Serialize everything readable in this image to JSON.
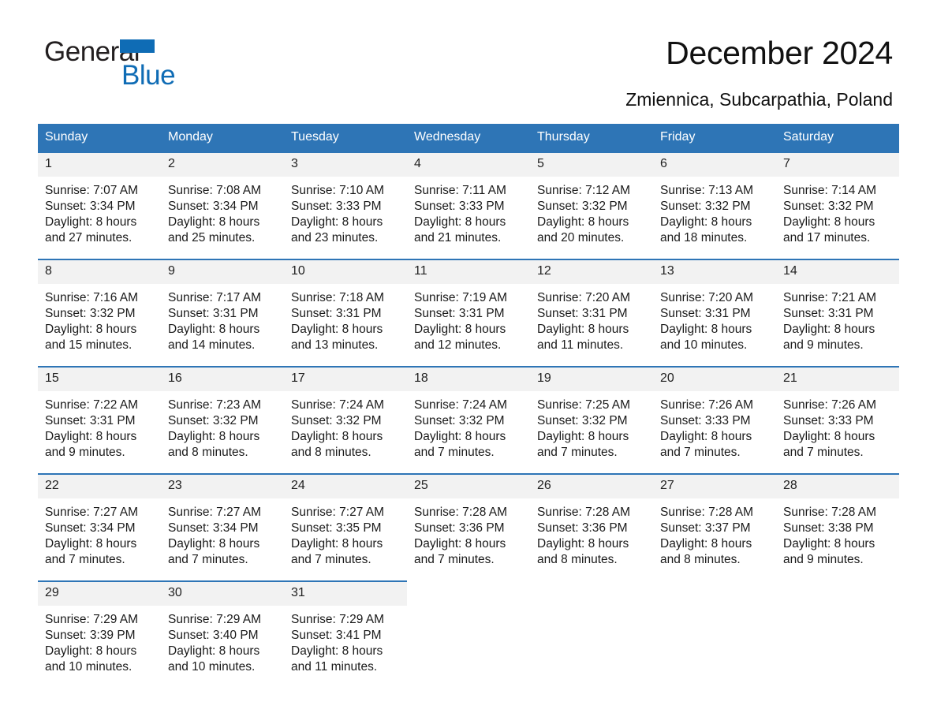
{
  "brand": {
    "logo_word_one": "General",
    "logo_word_two": "Blue",
    "logo_triangle_icon": "triangle-icon",
    "accent_color": "#0f6cb5"
  },
  "header": {
    "title": "December 2024",
    "subtitle": "Zmiennica, Subcarpathia, Poland"
  },
  "calendar": {
    "header_bg_color": "#2e75b6",
    "daynum_bg_color": "#f2f2f2",
    "weekday_headers": [
      "Sunday",
      "Monday",
      "Tuesday",
      "Wednesday",
      "Thursday",
      "Friday",
      "Saturday"
    ],
    "weeks": [
      [
        {
          "day": "1",
          "sunrise": "Sunrise: 7:07 AM",
          "sunset": "Sunset: 3:34 PM",
          "daylight_1": "Daylight: 8 hours",
          "daylight_2": "and 27 minutes."
        },
        {
          "day": "2",
          "sunrise": "Sunrise: 7:08 AM",
          "sunset": "Sunset: 3:34 PM",
          "daylight_1": "Daylight: 8 hours",
          "daylight_2": "and 25 minutes."
        },
        {
          "day": "3",
          "sunrise": "Sunrise: 7:10 AM",
          "sunset": "Sunset: 3:33 PM",
          "daylight_1": "Daylight: 8 hours",
          "daylight_2": "and 23 minutes."
        },
        {
          "day": "4",
          "sunrise": "Sunrise: 7:11 AM",
          "sunset": "Sunset: 3:33 PM",
          "daylight_1": "Daylight: 8 hours",
          "daylight_2": "and 21 minutes."
        },
        {
          "day": "5",
          "sunrise": "Sunrise: 7:12 AM",
          "sunset": "Sunset: 3:32 PM",
          "daylight_1": "Daylight: 8 hours",
          "daylight_2": "and 20 minutes."
        },
        {
          "day": "6",
          "sunrise": "Sunrise: 7:13 AM",
          "sunset": "Sunset: 3:32 PM",
          "daylight_1": "Daylight: 8 hours",
          "daylight_2": "and 18 minutes."
        },
        {
          "day": "7",
          "sunrise": "Sunrise: 7:14 AM",
          "sunset": "Sunset: 3:32 PM",
          "daylight_1": "Daylight: 8 hours",
          "daylight_2": "and 17 minutes."
        }
      ],
      [
        {
          "day": "8",
          "sunrise": "Sunrise: 7:16 AM",
          "sunset": "Sunset: 3:32 PM",
          "daylight_1": "Daylight: 8 hours",
          "daylight_2": "and 15 minutes."
        },
        {
          "day": "9",
          "sunrise": "Sunrise: 7:17 AM",
          "sunset": "Sunset: 3:31 PM",
          "daylight_1": "Daylight: 8 hours",
          "daylight_2": "and 14 minutes."
        },
        {
          "day": "10",
          "sunrise": "Sunrise: 7:18 AM",
          "sunset": "Sunset: 3:31 PM",
          "daylight_1": "Daylight: 8 hours",
          "daylight_2": "and 13 minutes."
        },
        {
          "day": "11",
          "sunrise": "Sunrise: 7:19 AM",
          "sunset": "Sunset: 3:31 PM",
          "daylight_1": "Daylight: 8 hours",
          "daylight_2": "and 12 minutes."
        },
        {
          "day": "12",
          "sunrise": "Sunrise: 7:20 AM",
          "sunset": "Sunset: 3:31 PM",
          "daylight_1": "Daylight: 8 hours",
          "daylight_2": "and 11 minutes."
        },
        {
          "day": "13",
          "sunrise": "Sunrise: 7:20 AM",
          "sunset": "Sunset: 3:31 PM",
          "daylight_1": "Daylight: 8 hours",
          "daylight_2": "and 10 minutes."
        },
        {
          "day": "14",
          "sunrise": "Sunrise: 7:21 AM",
          "sunset": "Sunset: 3:31 PM",
          "daylight_1": "Daylight: 8 hours",
          "daylight_2": "and 9 minutes."
        }
      ],
      [
        {
          "day": "15",
          "sunrise": "Sunrise: 7:22 AM",
          "sunset": "Sunset: 3:31 PM",
          "daylight_1": "Daylight: 8 hours",
          "daylight_2": "and 9 minutes."
        },
        {
          "day": "16",
          "sunrise": "Sunrise: 7:23 AM",
          "sunset": "Sunset: 3:32 PM",
          "daylight_1": "Daylight: 8 hours",
          "daylight_2": "and 8 minutes."
        },
        {
          "day": "17",
          "sunrise": "Sunrise: 7:24 AM",
          "sunset": "Sunset: 3:32 PM",
          "daylight_1": "Daylight: 8 hours",
          "daylight_2": "and 8 minutes."
        },
        {
          "day": "18",
          "sunrise": "Sunrise: 7:24 AM",
          "sunset": "Sunset: 3:32 PM",
          "daylight_1": "Daylight: 8 hours",
          "daylight_2": "and 7 minutes."
        },
        {
          "day": "19",
          "sunrise": "Sunrise: 7:25 AM",
          "sunset": "Sunset: 3:32 PM",
          "daylight_1": "Daylight: 8 hours",
          "daylight_2": "and 7 minutes."
        },
        {
          "day": "20",
          "sunrise": "Sunrise: 7:26 AM",
          "sunset": "Sunset: 3:33 PM",
          "daylight_1": "Daylight: 8 hours",
          "daylight_2": "and 7 minutes."
        },
        {
          "day": "21",
          "sunrise": "Sunrise: 7:26 AM",
          "sunset": "Sunset: 3:33 PM",
          "daylight_1": "Daylight: 8 hours",
          "daylight_2": "and 7 minutes."
        }
      ],
      [
        {
          "day": "22",
          "sunrise": "Sunrise: 7:27 AM",
          "sunset": "Sunset: 3:34 PM",
          "daylight_1": "Daylight: 8 hours",
          "daylight_2": "and 7 minutes."
        },
        {
          "day": "23",
          "sunrise": "Sunrise: 7:27 AM",
          "sunset": "Sunset: 3:34 PM",
          "daylight_1": "Daylight: 8 hours",
          "daylight_2": "and 7 minutes."
        },
        {
          "day": "24",
          "sunrise": "Sunrise: 7:27 AM",
          "sunset": "Sunset: 3:35 PM",
          "daylight_1": "Daylight: 8 hours",
          "daylight_2": "and 7 minutes."
        },
        {
          "day": "25",
          "sunrise": "Sunrise: 7:28 AM",
          "sunset": "Sunset: 3:36 PM",
          "daylight_1": "Daylight: 8 hours",
          "daylight_2": "and 7 minutes."
        },
        {
          "day": "26",
          "sunrise": "Sunrise: 7:28 AM",
          "sunset": "Sunset: 3:36 PM",
          "daylight_1": "Daylight: 8 hours",
          "daylight_2": "and 8 minutes."
        },
        {
          "day": "27",
          "sunrise": "Sunrise: 7:28 AM",
          "sunset": "Sunset: 3:37 PM",
          "daylight_1": "Daylight: 8 hours",
          "daylight_2": "and 8 minutes."
        },
        {
          "day": "28",
          "sunrise": "Sunrise: 7:28 AM",
          "sunset": "Sunset: 3:38 PM",
          "daylight_1": "Daylight: 8 hours",
          "daylight_2": "and 9 minutes."
        }
      ],
      [
        {
          "day": "29",
          "sunrise": "Sunrise: 7:29 AM",
          "sunset": "Sunset: 3:39 PM",
          "daylight_1": "Daylight: 8 hours",
          "daylight_2": "and 10 minutes."
        },
        {
          "day": "30",
          "sunrise": "Sunrise: 7:29 AM",
          "sunset": "Sunset: 3:40 PM",
          "daylight_1": "Daylight: 8 hours",
          "daylight_2": "and 10 minutes."
        },
        {
          "day": "31",
          "sunrise": "Sunrise: 7:29 AM",
          "sunset": "Sunset: 3:41 PM",
          "daylight_1": "Daylight: 8 hours",
          "daylight_2": "and 11 minutes."
        },
        {
          "day": "",
          "sunrise": "",
          "sunset": "",
          "daylight_1": "",
          "daylight_2": "",
          "empty": true
        },
        {
          "day": "",
          "sunrise": "",
          "sunset": "",
          "daylight_1": "",
          "daylight_2": "",
          "empty": true
        },
        {
          "day": "",
          "sunrise": "",
          "sunset": "",
          "daylight_1": "",
          "daylight_2": "",
          "empty": true
        },
        {
          "day": "",
          "sunrise": "",
          "sunset": "",
          "daylight_1": "",
          "daylight_2": "",
          "empty": true
        }
      ]
    ]
  }
}
